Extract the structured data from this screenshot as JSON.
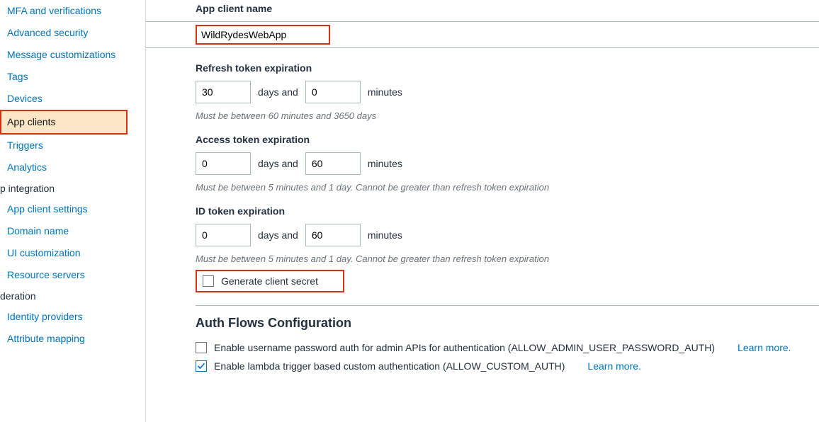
{
  "sidebar": {
    "items_general": [
      {
        "label": "MFA and verifications"
      },
      {
        "label": "Advanced security"
      },
      {
        "label": "Message customizations"
      },
      {
        "label": "Tags"
      },
      {
        "label": "Devices"
      },
      {
        "label": "App clients"
      },
      {
        "label": "Triggers"
      },
      {
        "label": "Analytics"
      }
    ],
    "section_integration": "p integration",
    "items_integration": [
      {
        "label": "App client settings"
      },
      {
        "label": "Domain name"
      },
      {
        "label": "UI customization"
      },
      {
        "label": "Resource servers"
      }
    ],
    "section_federation": "deration",
    "items_federation": [
      {
        "label": "Identity providers"
      },
      {
        "label": "Attribute mapping"
      }
    ]
  },
  "form": {
    "app_client_name_label": "App client name",
    "app_client_name_value": "WildRydesWebApp",
    "refresh_token": {
      "label": "Refresh token expiration",
      "days": "30",
      "days_and": "days and",
      "minutes": "0",
      "minutes_label": "minutes",
      "help": "Must be between 60 minutes and 3650 days"
    },
    "access_token": {
      "label": "Access token expiration",
      "days": "0",
      "days_and": "days and",
      "minutes": "60",
      "minutes_label": "minutes",
      "help": "Must be between 5 minutes and 1 day. Cannot be greater than refresh token expiration"
    },
    "id_token": {
      "label": "ID token expiration",
      "days": "0",
      "days_and": "days and",
      "minutes": "60",
      "minutes_label": "minutes",
      "help": "Must be between 5 minutes and 1 day. Cannot be greater than refresh token expiration"
    },
    "generate_client_secret": "Generate client secret",
    "auth_section_title": "Auth Flows Configuration",
    "auth_rows": [
      {
        "label": "Enable username password auth for admin APIs for authentication (ALLOW_ADMIN_USER_PASSWORD_AUTH)",
        "checked": false
      },
      {
        "label": "Enable lambda trigger based custom authentication (ALLOW_CUSTOM_AUTH)",
        "checked": true
      }
    ],
    "learn_more": "Learn more."
  }
}
